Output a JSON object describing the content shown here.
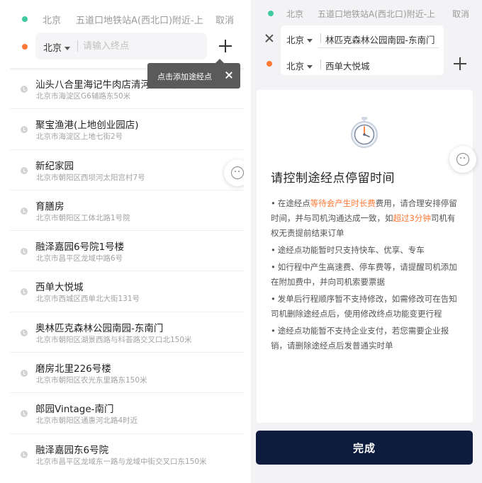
{
  "left": {
    "start": {
      "city": "北京",
      "address": "五道口地铁站A(西北口)附近-上",
      "cancel": "取消"
    },
    "end": {
      "city": "北京",
      "placeholder": "请输入终点"
    },
    "tooltip": "点击添加途经点",
    "items": [
      {
        "name": "汕头八合里海记牛肉店清河店停车场",
        "address": "北京市海淀区G6辅路东50米"
      },
      {
        "name": "聚宝渔港(上地创业园店)",
        "address": "北京市海淀区上地七街2号"
      },
      {
        "name": "新纪家园",
        "address": "北京市朝阳区西坝河太阳宫村7号"
      },
      {
        "name": "育膳房",
        "address": "北京市朝阳区工体北路1号院"
      },
      {
        "name": "融泽嘉园6号院1号楼",
        "address": "北京市昌平区龙域中路6号"
      },
      {
        "name": "西单大悦城",
        "address": "北京市西城区西单北大街131号"
      },
      {
        "name": "奥林匹克森林公园南园-东南门",
        "address": "北京市朝阳区湖景西路与科荟路交叉口北150米"
      },
      {
        "name": "磨房北里226号楼",
        "address": "北京市朝阳区农光东里路东150米"
      },
      {
        "name": "郎园Vintage-南门",
        "address": "北京市朝阳区通惠河北路4时近"
      },
      {
        "name": "融泽嘉园东6号院",
        "address": "北京市昌平区龙域东一路与龙域中街交叉口东150米"
      }
    ]
  },
  "right": {
    "start": {
      "city": "北京",
      "address": "五道口地铁站A(西北口)附近-上",
      "cancel": "取消"
    },
    "waypoint": {
      "city": "北京",
      "address": "林匹克森林公园南园-东南门"
    },
    "end": {
      "city": "北京",
      "address": "西单大悦城"
    },
    "card": {
      "title": "请控制途经点停留时间",
      "notes": [
        {
          "parts": [
            {
              "text": "在途经点",
              "hl": false
            },
            {
              "text": "等待会产生时长费",
              "hl": true
            },
            {
              "text": "费用，请合理安排停留时间，并与司机沟通达成一致，如",
              "hl": false
            },
            {
              "text": "超过3分钟",
              "hl": true
            },
            {
              "text": "司机有权无责提前结束订单",
              "hl": false
            }
          ]
        },
        {
          "parts": [
            {
              "text": "途经点功能暂时只支持快车、优享、专车",
              "hl": false
            }
          ]
        },
        {
          "parts": [
            {
              "text": "如行程中产生高速费、停车费等，请提醒司机添加在附加费中，并向司机索要票据",
              "hl": false
            }
          ]
        },
        {
          "parts": [
            {
              "text": "发单后行程顺序暂不支持修改，如需修改可在告知司机删除途经点后，使用修改终点功能变更行程",
              "hl": false
            }
          ]
        },
        {
          "parts": [
            {
              "text": "途经点功能暂不支持企业支付，若您需要企业报销，请删除途经点后发普通实时单",
              "hl": false
            }
          ]
        }
      ]
    },
    "done_label": "完成"
  },
  "colors": {
    "accent_orange": "#ff7a36",
    "start_green": "#3fc9a1",
    "done_button": "#0d1b3e"
  }
}
